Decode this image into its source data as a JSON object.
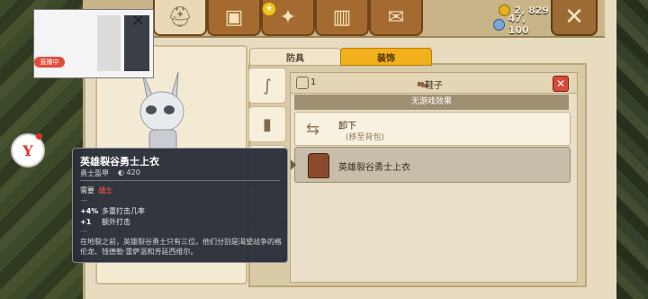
{
  "header": {
    "currency": [
      {
        "type": "coin",
        "value": "2, 829"
      },
      {
        "type": "gem",
        "value": "47, 100"
      }
    ],
    "tabs": [
      {
        "name": "helmet-icon"
      },
      {
        "name": "chest-icon"
      },
      {
        "name": "skills-icon"
      },
      {
        "name": "book-icon"
      },
      {
        "name": "scroll-icon"
      }
    ]
  },
  "sections": {
    "armor": "防具",
    "decoration": "装饰"
  },
  "item_panel": {
    "qty": "1",
    "name": "鞋子",
    "no_effect": "无游戏效果",
    "unequip": {
      "title": "卸下",
      "subtitle": "(移至背包)"
    },
    "equipped_item": "英雄裂谷勇士上衣"
  },
  "tooltip": {
    "title": "英雄裂谷勇士上衣",
    "type": "勇士盔甲",
    "armor": "420",
    "requirement_label": "需要",
    "requirement_class": "战士",
    "dash": "—",
    "stats": [
      {
        "value": "+4%",
        "label": "多重打击几率"
      },
      {
        "value": "+1",
        "label": "额外打击"
      }
    ],
    "description": "在地裂之前，英雄裂谷勇士只有三位。他们分别是渴望战争的格伦龙、钱德勒·雷萨温和芳廷西维尔。"
  },
  "stream": {
    "live_label": "直播中"
  },
  "logo": {
    "label": "Y"
  }
}
